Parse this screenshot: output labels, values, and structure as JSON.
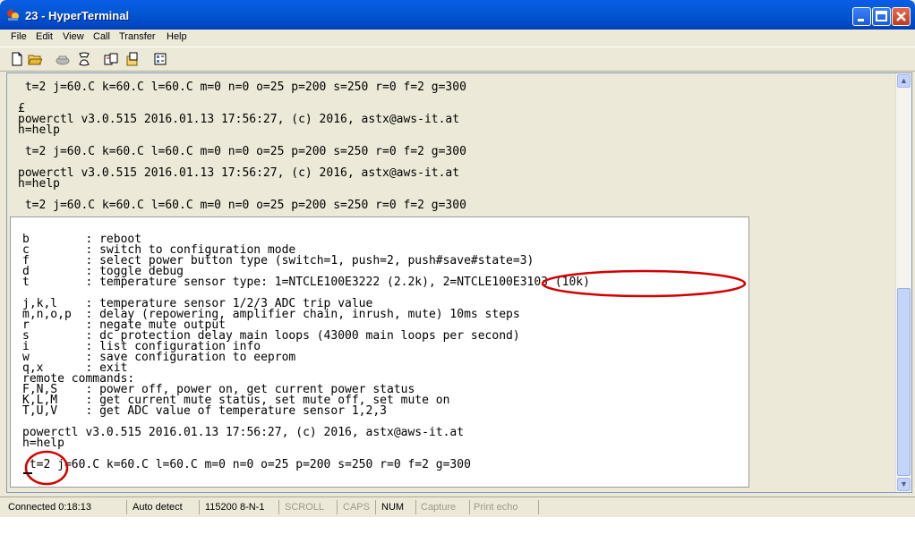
{
  "window": {
    "title": "23 - HyperTerminal"
  },
  "menu": [
    "File",
    "Edit",
    "View",
    "Call",
    "Transfer",
    "Help"
  ],
  "terminal": {
    "scrollback": " t=2 j=60.C k=60.C l=60.C m=0 n=0 o=25 p=200 s=250 r=0 f=2 g=300\n\n£\npowerctl v3.0.515 2016.01.13 17:56:27, (c) 2016, astx@aws-it.at\nh=help\n\n t=2 j=60.C k=60.C l=60.C m=0 n=0 o=25 p=200 s=250 r=0 f=2 g=300\n\npowerctl v3.0.515 2016.01.13 17:56:27, (c) 2016, astx@aws-it.at\nh=help\n\n t=2 j=60.C k=60.C l=60.C m=0 n=0 o=25 p=200 s=250 r=0 f=2 g=300",
    "screen": "b        : reboot\nc        : switch to configuration mode\nf        : select power button type (switch=1, push=2, push#save#state=3)\nd        : toggle debug\nt        : temperature sensor type: 1=NTCLE100E3222 (2.2k), 2=NTCLE100E3103 (10k)\n\nj,k,l    : temperature sensor 1/2/3 ADC trip value\nm,n,o,p  : delay (repowering, amplifier chain, inrush, mute) 10ms steps\nr        : negate mute output\ns        : dc protection delay main loops (43000 main loops per second)\ni        : list configuration info\nw        : save configuration to eeprom\nq,x      : exit\nremote commands:\nF,N,S    : power off, power on, get current power status\nK,L,M    : get current mute status, set mute off, set mute on\nT,U,V    : get ADC value of temperature sensor 1,2,3\n\npowerctl v3.0.515 2016.01.13 17:56:27, (c) 2016, astx@aws-it.at\nh=help\n\n t=2 j=60.C k=60.C l=60.C m=0 n=0 o=25 p=200 s=250 r=0 f=2 g=300"
  },
  "status": {
    "connected": "Connected 0:18:13",
    "detect": "Auto detect",
    "baud": "115200 8-N-1",
    "scroll": "SCROLL",
    "caps": "CAPS",
    "num": "NUM",
    "capture": "Capture",
    "print_echo": "Print echo"
  },
  "colors": {
    "annotation": "#d40000",
    "titlebar": "#0058e6"
  }
}
